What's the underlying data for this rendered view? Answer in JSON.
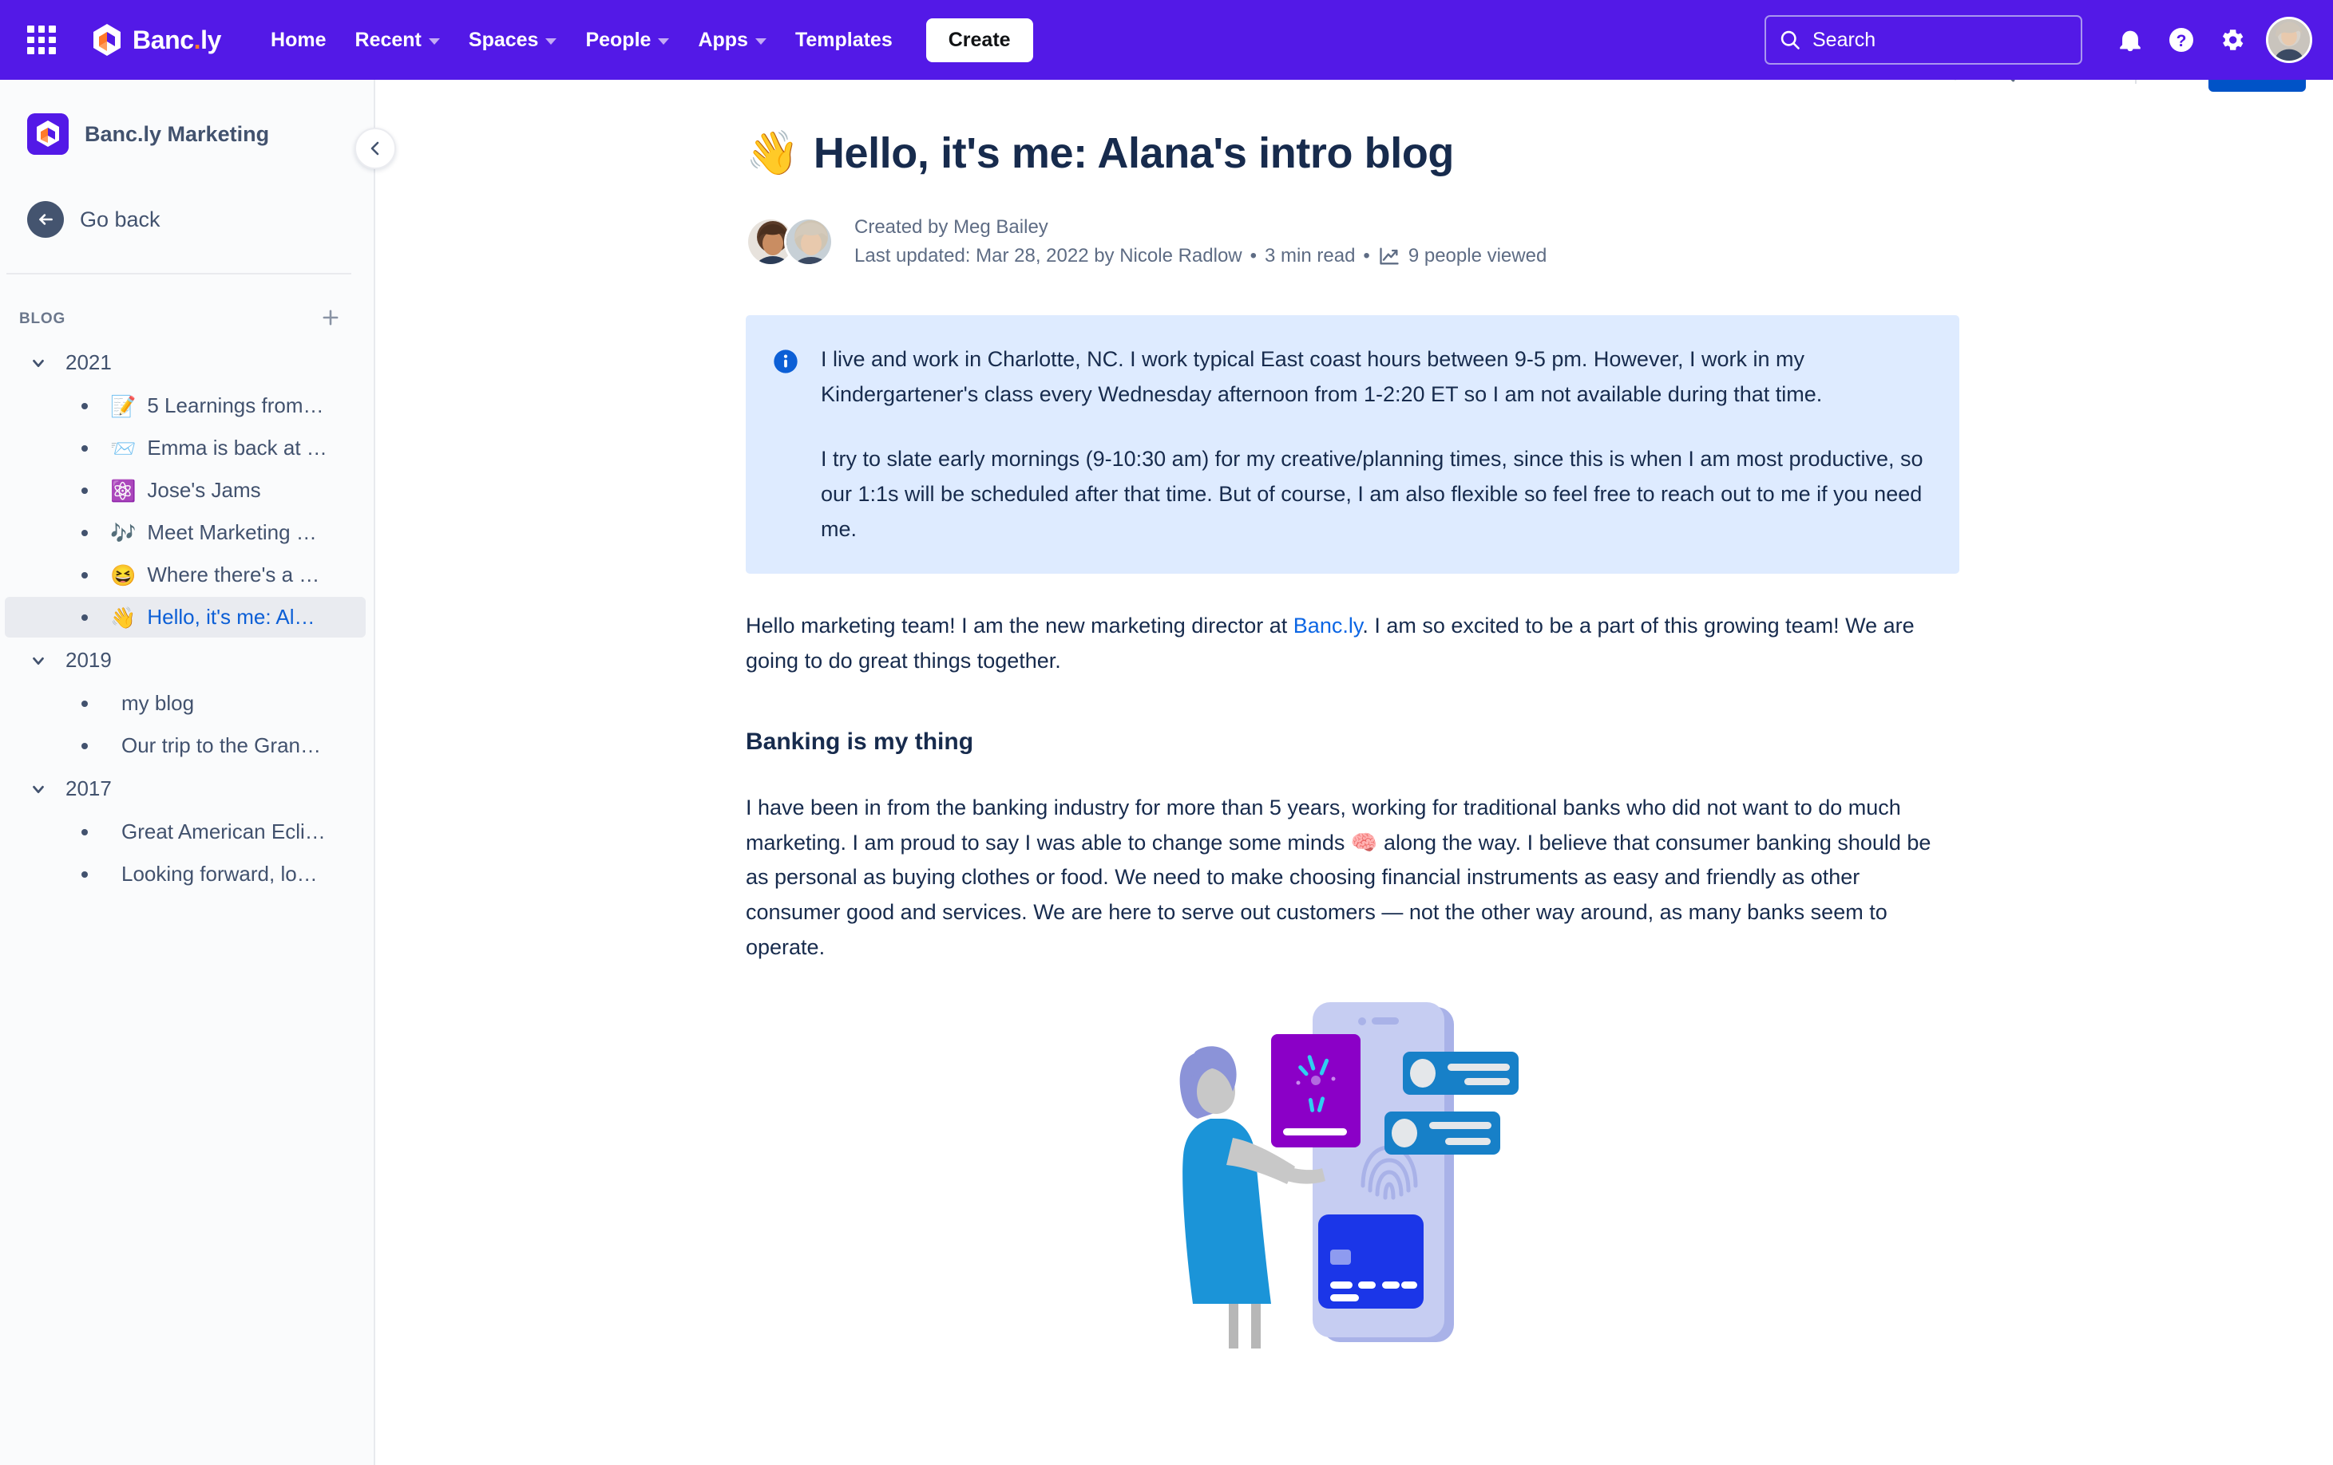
{
  "topnav": {
    "app_switcher_icon": "grid-apps-icon",
    "brand": {
      "name_main": "Banc",
      "name_dot": ".",
      "name_suffix": "ly",
      "logo_icon": "bancly-logo-icon"
    },
    "links": [
      {
        "label": "Home",
        "has_caret": false
      },
      {
        "label": "Recent",
        "has_caret": true
      },
      {
        "label": "Spaces",
        "has_caret": true
      },
      {
        "label": "People",
        "has_caret": true
      },
      {
        "label": "Apps",
        "has_caret": true
      },
      {
        "label": "Templates",
        "has_caret": false
      }
    ],
    "create_label": "Create",
    "search": {
      "placeholder": "Search",
      "value": "",
      "icon": "search-icon"
    },
    "notifications_icon": "bell-icon",
    "help_icon": "question-circle-icon",
    "settings_icon": "gear-icon",
    "avatar_icon": "user-avatar",
    "bg_color": "#5319e7"
  },
  "subtoolbar": {
    "icons": [
      "comment-icon",
      "search-page-icon",
      "star-icon",
      "watch-eye-icon",
      "more-actions-icon"
    ],
    "share_label": "",
    "share_color": "#0053c7"
  },
  "sidebar": {
    "space_title": "Banc.ly Marketing",
    "space_logo_icon": "bancly-space-logo-icon",
    "collapse_icon": "chevron-left-icon",
    "go_back_label": "Go back",
    "go_back_icon": "arrow-left-icon",
    "section_label": "BLOG",
    "add_icon": "plus-icon",
    "tree": [
      {
        "label": "2021",
        "expanded": true,
        "children": [
          {
            "emoji": "📝",
            "label": "5 Learnings from…",
            "selected": false
          },
          {
            "emoji": "📨",
            "label": "Emma is back at …",
            "selected": false
          },
          {
            "emoji": "⚛️",
            "label": "Jose's Jams",
            "selected": false
          },
          {
            "emoji": "🎶",
            "label": "Meet Marketing …",
            "selected": false
          },
          {
            "emoji": "😆",
            "label": "Where there's a …",
            "selected": false
          },
          {
            "emoji": "👋",
            "label": "Hello, it's me: Al…",
            "selected": true
          }
        ]
      },
      {
        "label": "2019",
        "expanded": true,
        "children": [
          {
            "emoji": "",
            "label": "my blog",
            "selected": false
          },
          {
            "emoji": "",
            "label": "Our trip to the Gran…",
            "selected": false
          }
        ]
      },
      {
        "label": "2017",
        "expanded": true,
        "children": [
          {
            "emoji": "",
            "label": "Great American Ecli…",
            "selected": false
          },
          {
            "emoji": "",
            "label": "Looking forward, lo…",
            "selected": false
          }
        ]
      }
    ]
  },
  "article": {
    "title_emoji": "👋",
    "title": "Hello, it's me: Alana's intro blog",
    "created_by": "Created by Meg Bailey",
    "last_updated": "Last updated: Mar 28, 2022 by Nicole Radlow",
    "read_time": "3 min read",
    "views": "9 people viewed",
    "views_icon": "analytics-chart-icon",
    "separator": "•",
    "callout": {
      "icon": "info-circle-icon",
      "bg_color": "#deebff",
      "paragraphs": [
        "I live and work in Charlotte, NC. I work typical East coast hours between 9-5 pm. However, I work in my Kindergartener's class every Wednesday afternoon from 1-2:20 ET so I am not available during that time.",
        "I try to slate early mornings (9-10:30 am) for my creative/planning times, since this is when I am most productive, so our 1:1s will be scheduled after that time. But of course, I am also flexible so feel free to reach out to me if you need me."
      ]
    },
    "intro_before_link": "Hello marketing team! I am the new marketing director at ",
    "intro_link": "Banc.ly",
    "intro_after_link": ". I am so excited to be a part of this growing team! We are going to do great things together.",
    "heading_banking": "Banking is my thing",
    "banking_paragraph": "I have been in from the banking industry for more than 5 years, working for traditional banks who did not want to do much marketing. I am proud to say I was able to change some minds 🧠 along the way. I believe that consumer banking should be as personal as buying clothes or food. We need to make choosing financial instruments as easy and friendly as other consumer good and services. We are here to serve out customers — not the other way around, as many banks seem to operate.",
    "illustration_name": "woman-with-phone-banking-illustration"
  }
}
